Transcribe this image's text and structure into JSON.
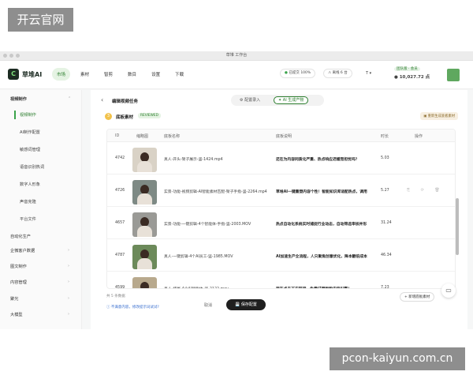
{
  "watermarks": {
    "top_left": "开云官网",
    "bottom_right": "pcon-kaiyun.com.cn"
  },
  "window": {
    "title": "草堆 工作台"
  },
  "brand": {
    "name": "草堆AI"
  },
  "nav": {
    "tabs": [
      "市场",
      "素材",
      "智剪",
      "数目",
      "设置",
      "下载"
    ],
    "active": "市场"
  },
  "status": {
    "uploaded_label": "已提交",
    "uploaded_percent": "100%",
    "warning_label": "离线 6 台"
  },
  "language": "T ▾",
  "account": {
    "tag": "团队版 · 会员",
    "balance": "● 10,027.72 点"
  },
  "sidebar": {
    "sections": [
      {
        "label": "视频制作",
        "expanded": true,
        "children": [
          "视频制作",
          "AI制作配置",
          "敏感词管理",
          "语音识别热词",
          "数字人形象",
          "声音克隆",
          "平台文件"
        ]
      },
      {
        "label": "自动化生产"
      },
      {
        "label": "企微客户数据"
      },
      {
        "label": "图文制作"
      },
      {
        "label": "内容管理"
      },
      {
        "label": "聚光"
      },
      {
        "label": "大模型"
      }
    ],
    "active_child": "视频制作"
  },
  "page": {
    "back_label": "‹",
    "title": "编辑视频任务",
    "segments": [
      {
        "label": "⚙ 配置录入"
      },
      {
        "label": "✦ AI 生成产物"
      }
    ],
    "active_segment": 1
  },
  "section": {
    "step": "3",
    "title": "底板素材",
    "badge": "REVIEWED",
    "regen_label": "▣ 重新生成底板素材"
  },
  "table": {
    "columns": [
      "ID",
      "缩略图",
      "底板名称",
      "底板说明",
      "时长",
      "操作"
    ],
    "rows": [
      {
        "id": "4742",
        "name": "真人-开头-架子展示-竖-1424.mp4",
        "desc": "还在为内容同质化严重、热点响应迟缓而担忧吗？",
        "duration": "5.03",
        "thumb_bg": "#d9d2c6"
      },
      {
        "id": "4726",
        "name": "实景-功能-视频剪辑-AI智能素材匹配-架子手指-竖-2264.mp4",
        "desc": "草堆AI一键重塑内容个性！智能知识库适配热点，调用",
        "duration": "5.27",
        "thumb_bg": "#7e8a85",
        "actions": "⎘ ⟳ 🗑"
      },
      {
        "id": "4657",
        "name": "实景-功能-一键剪辑-4个智能体-手指-竖-2003.MOV",
        "desc": "热点自动化系统实时捕捉行业动态，自动筛选审核并形",
        "duration": "31.24",
        "thumb_bg": "#9a9a96"
      },
      {
        "id": "4787",
        "name": "真人-一键剪辑-4个AI员工-竖-1985.MOV",
        "desc": "AI加速生产全流程，人只聚焦创意优化，降本翻倍成本",
        "duration": "46.34",
        "thumb_bg": "#6c8a5a"
      },
      {
        "id": "4599",
        "name": "真人-结尾-4个AI智能体-竖-2122.mov",
        "desc": "现在点击下方链接，免费试用智能内容引擎！",
        "duration": "7.23",
        "thumb_bg": "#b8a98d"
      }
    ]
  },
  "footer": {
    "total": "共 5 条数据",
    "add_label": "+ 新增底板素材",
    "hint": "ⓘ 不满意内容，修改提示词试试?",
    "cancel": "取消",
    "save": "💾 保存配置"
  },
  "chat_icon": "▭"
}
